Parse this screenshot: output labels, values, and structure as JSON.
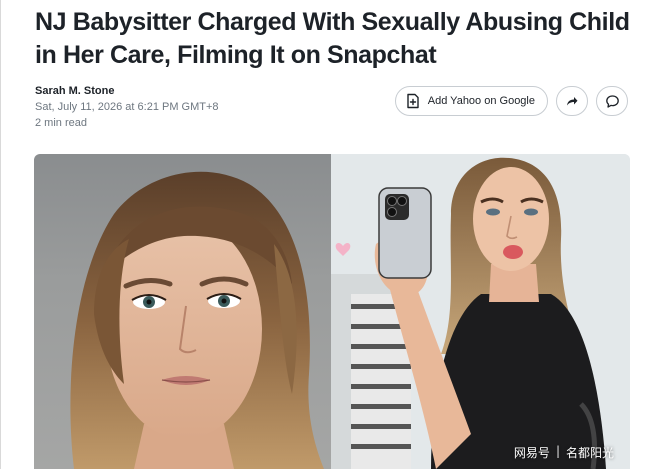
{
  "article": {
    "headline": "NJ Babysitter Charged With Sexually Abusing Child in Her Care, Filming It on Snapchat",
    "author": "Sarah M. Stone",
    "date": "Sat, July 11, 2026 at 6:21 PM GMT+8",
    "read_time": "2 min read"
  },
  "actions": {
    "add_yahoo_label": "Add Yahoo on Google",
    "add_icon": "google-add-icon",
    "share_icon": "share-arrow-icon",
    "comment_icon": "comment-bubble-icon"
  },
  "images": {
    "left": "mugshot-photo",
    "right": "mirror-selfie-photo"
  },
  "watermark": {
    "source": "网易号",
    "separator": "|",
    "account": "名都阳光"
  },
  "colors": {
    "text": "#1d2228",
    "muted": "#6e7780",
    "border": "#c8cdd2"
  }
}
